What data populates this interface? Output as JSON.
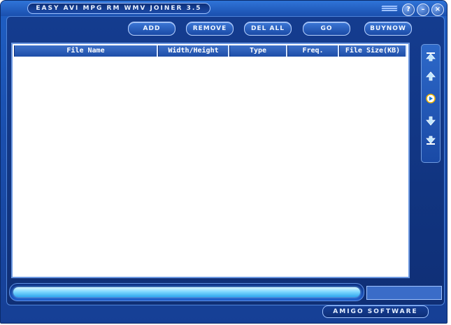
{
  "window": {
    "title": "EASY AVI MPG RM WMV JOINER 3.5",
    "help_label": "?",
    "minimize_label": "–",
    "close_label": "×"
  },
  "toolbar": {
    "add_label": "ADD",
    "remove_label": "REMOVE",
    "delall_label": "DEL ALL",
    "go_label": "GO",
    "buynow_label": "BUYNOW"
  },
  "table": {
    "columns": [
      "File Name",
      "Width/Height",
      "Type",
      "Freq.",
      "File Size(KB)"
    ],
    "rows": []
  },
  "sidebar": {
    "icons": [
      "move-top-icon",
      "move-up-icon",
      "play-icon",
      "move-down-icon",
      "move-bottom-icon"
    ]
  },
  "progress": {
    "value": 1.0
  },
  "footer": {
    "brand": "AMIGO SOFTWARE"
  },
  "colors": {
    "accent": "#1a4fae",
    "progress": "#7fd8ff"
  }
}
